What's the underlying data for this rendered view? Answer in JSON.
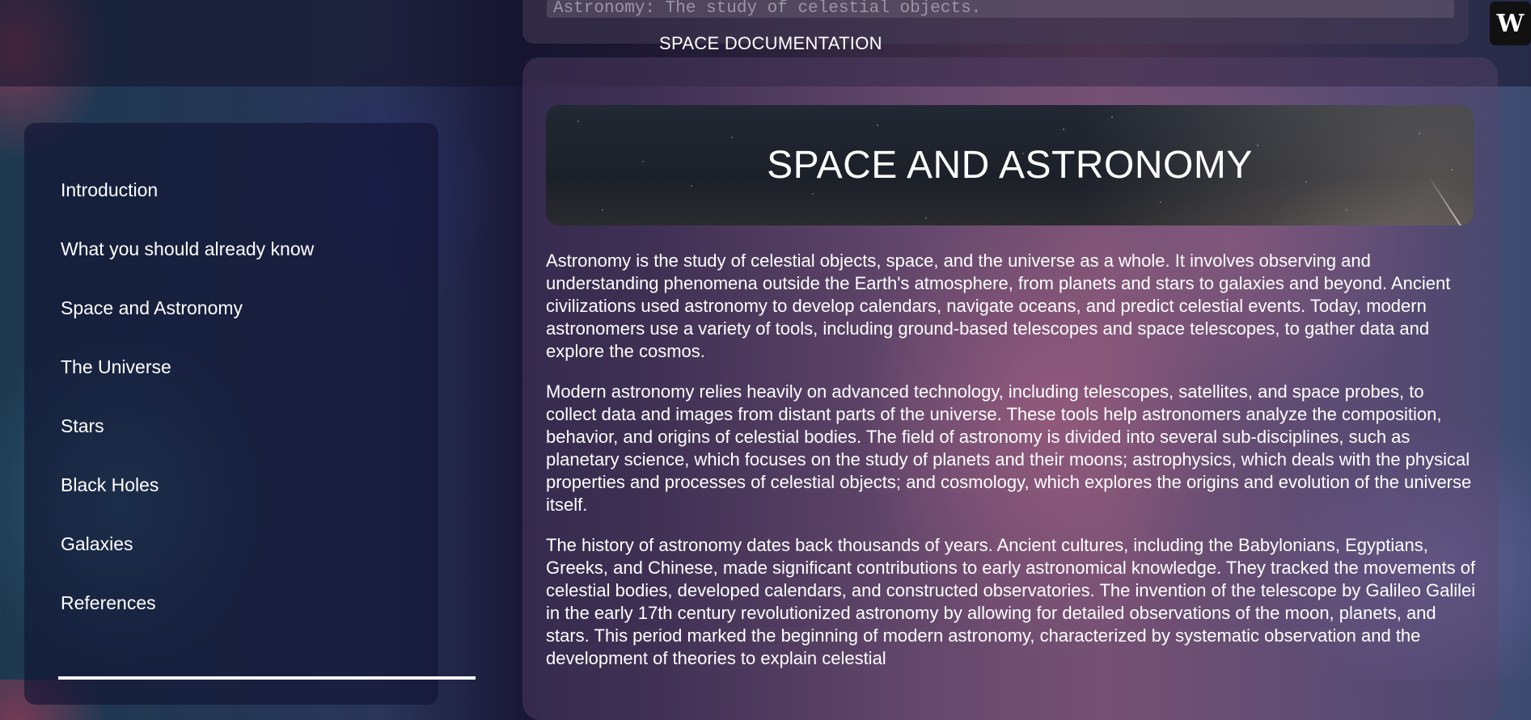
{
  "header": {
    "search_placeholder": "Astronomy: The study of celestial objects.",
    "brand_title": "SPACE DOCUMENTATION",
    "logo_text": "W"
  },
  "sidebar": {
    "items": [
      {
        "label": "Introduction"
      },
      {
        "label": "What you should already know"
      },
      {
        "label": "Space and Astronomy"
      },
      {
        "label": "The Universe"
      },
      {
        "label": "Stars"
      },
      {
        "label": "Black Holes"
      },
      {
        "label": "Galaxies"
      },
      {
        "label": "References"
      }
    ]
  },
  "main": {
    "hero_title": "SPACE AND ASTRONOMY",
    "paragraphs": [
      "Astronomy is the study of celestial objects, space, and the universe as a whole. It involves observing and understanding phenomena outside the Earth's atmosphere, from planets and stars to galaxies and beyond. Ancient civilizations used astronomy to develop calendars, navigate oceans, and predict celestial events. Today, modern astronomers use a variety of tools, including ground-based telescopes and space telescopes, to gather data and explore the cosmos.",
      "Modern astronomy relies heavily on advanced technology, including telescopes, satellites, and space probes, to collect data and images from distant parts of the universe. These tools help astronomers analyze the composition, behavior, and origins of celestial bodies. The field of astronomy is divided into several sub-disciplines, such as planetary science, which focuses on the study of planets and their moons; astrophysics, which deals with the physical properties and processes of celestial objects; and cosmology, which explores the origins and evolution of the universe itself.",
      "The history of astronomy dates back thousands of years. Ancient cultures, including the Babylonians, Egyptians, Greeks, and Chinese, made significant contributions to early astronomical knowledge. They tracked the movements of celestial bodies, developed calendars, and constructed observatories. The invention of the telescope by Galileo Galilei in the early 17th century revolutionized astronomy by allowing for detailed observations of the moon, planets, and stars. This period marked the beginning of modern astronomy, characterized by systematic observation and the development of theories to explain celestial"
    ]
  }
}
